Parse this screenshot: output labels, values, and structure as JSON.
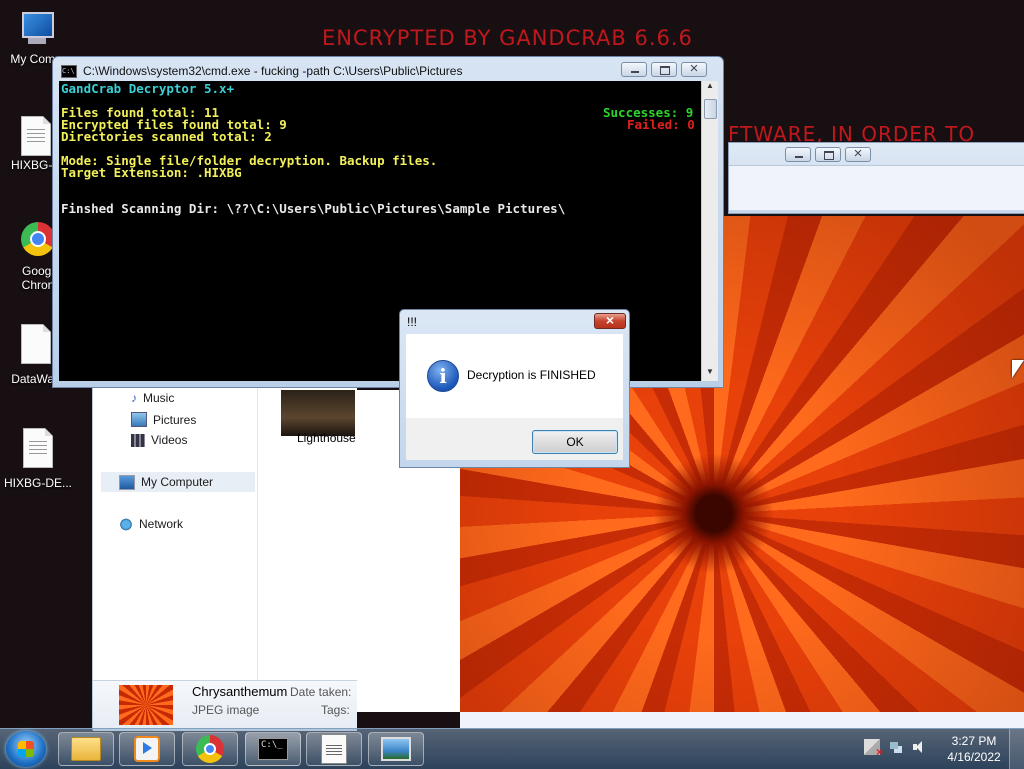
{
  "desktop": {
    "wallpaper_title": "ENCRYPTED BY GANDCRAB 6.6.6",
    "wallpaper_line2": "FTWARE, IN ORDER TO",
    "icons": [
      {
        "label": "My Comp",
        "icon": "computer-icon"
      },
      {
        "label": "HIXBG-D",
        "icon": "document-icon"
      },
      {
        "label": "Googl",
        "label2": "Chron",
        "icon": "chrome-icon"
      },
      {
        "label": "DataWag",
        "icon": "document-icon"
      },
      {
        "label": "HIXBG-DE...",
        "icon": "document-icon"
      }
    ]
  },
  "cmd": {
    "title": "C:\\Windows\\system32\\cmd.exe - fucking  -path C:\\Users\\Public\\Pictures",
    "lines": {
      "header": "GandCrab Decryptor 5.x+",
      "files_found": "Files found total: 11",
      "encrypted_found": "Encrypted files found total: 9",
      "dirs_scanned": "Directories scanned total: 2",
      "mode": "Mode: Single file/folder decryption. Backup files.",
      "target_ext": "Target Extension: .HIXBG",
      "finished_dir": "Finshed Scanning Dir: \\??\\C:\\Users\\Public\\Pictures\\Sample Pictures\\",
      "successes": "Successes: 9",
      "failed": "Failed: 0"
    },
    "colors": {
      "cyan": "#3ad0d6",
      "yellow": "#f2f05a",
      "green": "#2bd62b",
      "red": "#e0201c"
    }
  },
  "msgbox": {
    "title": "!!!",
    "message": "Decryption is FINISHED",
    "ok_label": "OK",
    "icon": "info-icon"
  },
  "explorer": {
    "nav": {
      "music": "Music",
      "pictures": "Pictures",
      "videos": "Videos",
      "my_computer": "My Computer",
      "network": "Network"
    },
    "thumb_label": "Lighthouse",
    "details": {
      "name": "Chrysanthemum",
      "type": "JPEG image",
      "date_taken_label": "Date taken:",
      "tags_label": "Tags:"
    }
  },
  "taskbar": {
    "apps": [
      "folder-icon",
      "media-player-icon",
      "chrome-icon",
      "cmd-icon",
      "notepad-icon",
      "photo-viewer-icon"
    ],
    "clock_time": "3:27 PM",
    "clock_date": "4/16/2022"
  }
}
